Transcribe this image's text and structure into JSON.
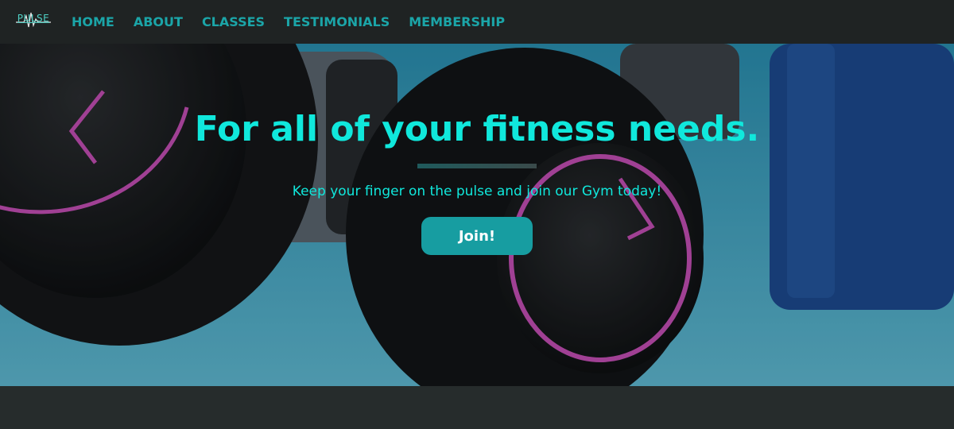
{
  "brand": {
    "logo_text": "PULSE"
  },
  "nav": {
    "items": [
      {
        "label": "HOME"
      },
      {
        "label": "ABOUT"
      },
      {
        "label": "CLASSES"
      },
      {
        "label": "TESTIMONIALS"
      },
      {
        "label": "MEMBERSHIP"
      }
    ]
  },
  "hero": {
    "title": "For all of your fitness needs.",
    "subtitle": "Keep your finger on the pulse and join our Gym today!",
    "cta_label": "Join!"
  },
  "colors": {
    "accent": "#10e8dc",
    "nav_link": "#1ba5a8",
    "button": "#179da1",
    "navbar_bg": "#1f2323",
    "page_bg": "#262c2c"
  }
}
